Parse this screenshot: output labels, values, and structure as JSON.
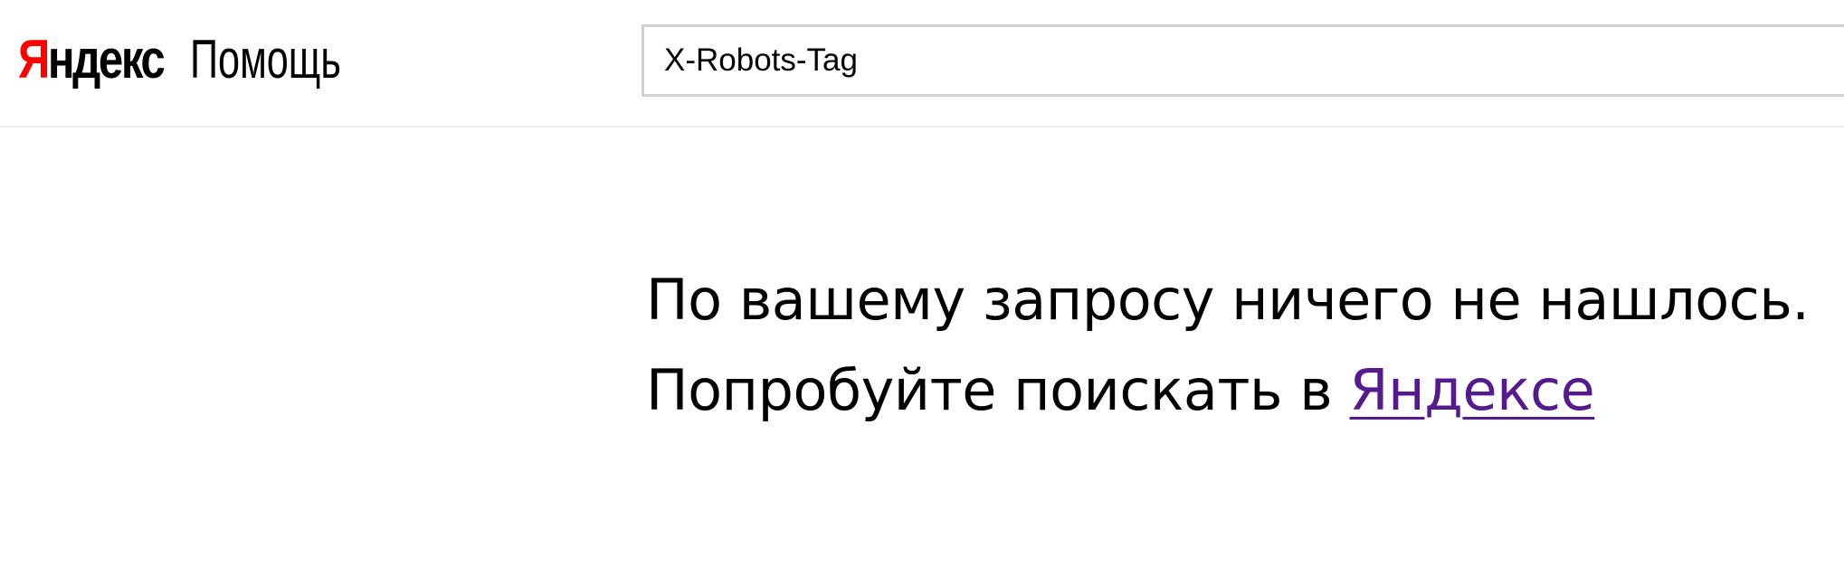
{
  "header": {
    "logo": {
      "brand_first_letter": "Я",
      "brand_rest": "ндекс",
      "service": "Помощь"
    },
    "search": {
      "value": "X-Robots-Tag"
    }
  },
  "main": {
    "not_found_text": "По вашему запросу ничего не нашлось.",
    "suggest_prefix": "Попробуйте поискать в ",
    "suggest_link": "Яндексе"
  },
  "colors": {
    "brand_red": "#ff0000",
    "visited_link": "#551a8b"
  }
}
